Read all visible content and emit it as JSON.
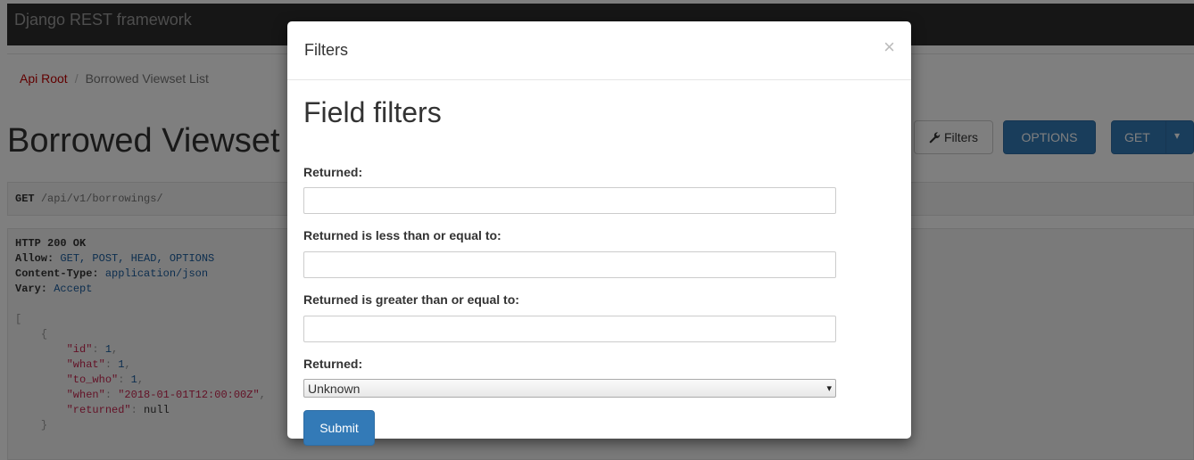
{
  "app": {
    "brand": "Django REST framework"
  },
  "breadcrumb": {
    "root": "Api Root",
    "separator": "/",
    "current": "Borrowed Viewset List"
  },
  "page": {
    "title": "Borrowed Viewset List"
  },
  "toolbar": {
    "filters_label": "Filters",
    "options_label": "OPTIONS",
    "get_label": "GET",
    "dropdown_caret": "▾"
  },
  "request": {
    "method": "GET",
    "url": "/api/v1/borrowings/"
  },
  "response": {
    "status": "HTTP 200 OK",
    "headers": [
      {
        "key": "Allow:",
        "value": "GET, POST, HEAD, OPTIONS"
      },
      {
        "key": "Content-Type:",
        "value": "application/json"
      },
      {
        "key": "Vary:",
        "value": "Accept"
      }
    ],
    "open_bracket": "[",
    "open_brace": "{",
    "fields": [
      {
        "key": "\"id\"",
        "value": "1",
        "comma": ","
      },
      {
        "key": "\"what\"",
        "value": "1",
        "comma": ","
      },
      {
        "key": "\"to_who\"",
        "value": "1",
        "comma": ","
      },
      {
        "key": "\"when\"",
        "value": "\"2018-01-01T12:00:00Z\"",
        "comma": ","
      },
      {
        "key": "\"returned\"",
        "value": "null",
        "comma": ""
      }
    ],
    "close_brace": "}"
  },
  "modal": {
    "title": "Filters",
    "close_symbol": "×",
    "heading": "Field filters",
    "fields": [
      {
        "label": "Returned:",
        "value": ""
      },
      {
        "label": "Returned is less than or equal to:",
        "value": ""
      },
      {
        "label": "Returned is greater than or equal to:",
        "value": ""
      }
    ],
    "select": {
      "label": "Returned:",
      "selected": "Unknown",
      "arrow": "▾"
    },
    "submit_label": "Submit"
  },
  "colors": {
    "navbar": "#2c2c2c",
    "primary": "#337ab7",
    "breadcrumb_link": "#c20000"
  }
}
